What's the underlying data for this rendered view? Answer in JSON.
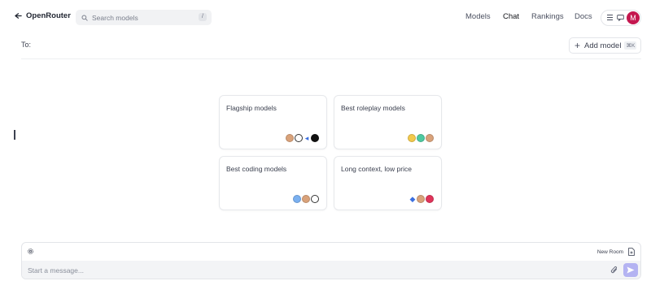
{
  "header": {
    "brand": "OpenRouter",
    "search": {
      "placeholder": "Search models",
      "shortcut": "/"
    },
    "nav": [
      {
        "label": "Models",
        "active": false
      },
      {
        "label": "Chat",
        "active": true
      },
      {
        "label": "Rankings",
        "active": false
      },
      {
        "label": "Docs",
        "active": false
      }
    ],
    "avatar_initial": "M",
    "avatar_color": "#c4174f"
  },
  "to_bar": {
    "label": "To:",
    "add_model_label": "Add model",
    "add_model_shortcut": "⌘K"
  },
  "cards": [
    {
      "title": "Flagship models",
      "icons": [
        "anthropic-icon",
        "openai-icon",
        "gemini-icon",
        "meta-icon"
      ]
    },
    {
      "title": "Best roleplay models",
      "icons": [
        "model-icon-yellow",
        "model-icon-green",
        "anthropic-icon"
      ]
    },
    {
      "title": "Best coding models",
      "icons": [
        "model-icon-blue",
        "anthropic-icon",
        "openai-icon"
      ]
    },
    {
      "title": "Long context, low price",
      "icons": [
        "gemini-icon",
        "anthropic-icon",
        "model-icon-red"
      ]
    }
  ],
  "composer": {
    "new_room_label": "New Room",
    "placeholder": "Start a message...",
    "send_color": "#b4b3f2"
  }
}
